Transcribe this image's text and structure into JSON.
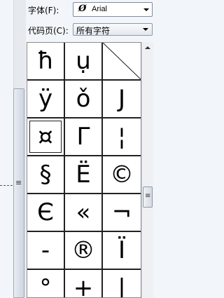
{
  "font_row": {
    "label": "字体(F):",
    "value": "Arial",
    "type_icon": "Ø"
  },
  "charset_row": {
    "label": "代码页(C):",
    "value": "所有字符"
  },
  "grid": {
    "columns": 3,
    "selected_index": 6,
    "cells": [
      "ħ",
      "ụ",
      "",
      "ÿ",
      "ǒ",
      "J",
      "¤",
      "Γ",
      "¦",
      "§",
      "Ë",
      "©",
      "Є",
      "«",
      "¬",
      "-",
      "®",
      "Ï",
      "°",
      "+",
      "|"
    ]
  },
  "icons": {
    "left_grip": "≡",
    "right_grip": "≡"
  }
}
